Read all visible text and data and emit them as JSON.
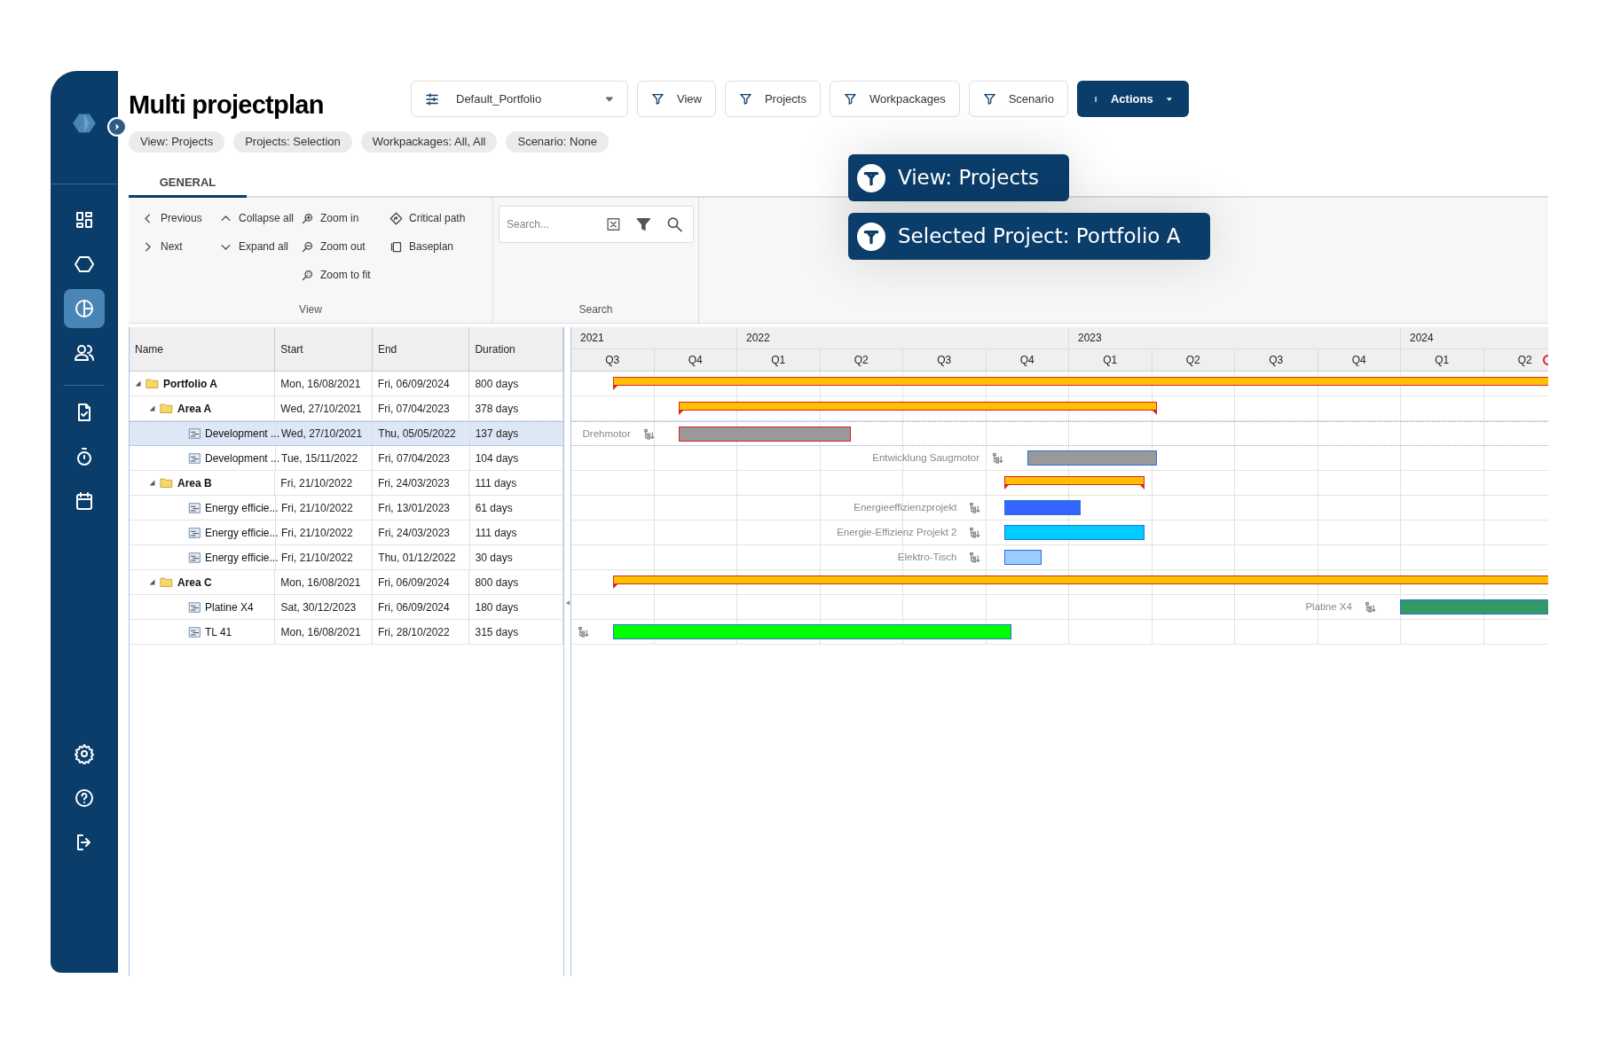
{
  "sidebar": {
    "nav_top": [
      {
        "selected": false
      },
      {
        "selected": false
      },
      {
        "selected": true
      },
      {
        "selected": false
      }
    ],
    "nav_middle": [
      {
        "selected": false
      },
      {
        "selected": false
      },
      {
        "selected": false
      }
    ],
    "nav_bottom": [
      {
        "selected": false
      },
      {
        "selected": false
      },
      {
        "selected": false
      }
    ]
  },
  "header": {
    "title": "Multi projectplan",
    "portfolio_select": {
      "value": "Default_Portfolio"
    },
    "filter_buttons": [
      "View",
      "Projects",
      "Workpackages",
      "Scenario"
    ],
    "actions_button": "Actions",
    "chips": [
      "View: Projects",
      "Projects: Selection",
      "Workpackages: All, All",
      "Scenario: None"
    ]
  },
  "callouts": [
    "View: Projects",
    "Selected Project: Portfolio A"
  ],
  "tabs": [
    {
      "label": "GENERAL",
      "selected": true
    }
  ],
  "ribbon": {
    "view_group": {
      "label": "View",
      "columns": [
        [
          {
            "kind": "previous",
            "label": "Previous"
          },
          {
            "kind": "next",
            "label": "Next"
          }
        ],
        [
          {
            "kind": "collapse",
            "label": "Collapse all"
          },
          {
            "kind": "expand",
            "label": "Expand all"
          }
        ],
        [
          {
            "kind": "zoom_in",
            "label": "Zoom in"
          },
          {
            "kind": "zoom_out",
            "label": "Zoom out"
          },
          {
            "kind": "zoom_fit",
            "label": "Zoom to fit"
          }
        ],
        [
          {
            "kind": "critical",
            "label": "Critical path"
          },
          {
            "kind": "baseplan",
            "label": "Baseplan"
          }
        ]
      ]
    },
    "search_group": {
      "label": "Search",
      "placeholder": "Search..."
    }
  },
  "table": {
    "columns": [
      "Name",
      "Start",
      "End",
      "Duration"
    ],
    "rows": [
      {
        "kind": "folder",
        "name": "Portfolio A",
        "start": "Mon, 16/08/2021",
        "end": "Fri, 06/09/2024",
        "duration": "800 days",
        "expanded": true,
        "selected": false,
        "children": [
          {
            "kind": "folder",
            "name": "Area A",
            "start": "Wed, 27/10/2021",
            "end": "Fri, 07/04/2023",
            "duration": "378 days",
            "expanded": true,
            "selected": false,
            "children": [
              {
                "kind": "task",
                "name": "Development ...",
                "start": "Wed, 27/10/2021",
                "end": "Thu, 05/05/2022",
                "duration": "137 days",
                "selected": true,
                "bar_label": "Drehmotor",
                "color": "#999999",
                "critical": true
              },
              {
                "kind": "task",
                "name": "Development ...",
                "start": "Tue, 15/11/2022",
                "end": "Fri, 07/04/2023",
                "duration": "104 days",
                "selected": false,
                "bar_label": "Entwicklung Saugmotor",
                "color": "#999999",
                "critical": false
              }
            ]
          },
          {
            "kind": "folder",
            "name": "Area B",
            "start": "Fri, 21/10/2022",
            "end": "Fri, 24/03/2023",
            "duration": "111 days",
            "expanded": true,
            "selected": false,
            "children": [
              {
                "kind": "task",
                "name": "Energy efficie...",
                "start": "Fri, 21/10/2022",
                "end": "Fri, 13/01/2023",
                "duration": "61 days",
                "selected": false,
                "bar_label": "Energieeffizienzprojekt",
                "color": "#3366ff",
                "critical": false
              },
              {
                "kind": "task",
                "name": "Energy efficie...",
                "start": "Fri, 21/10/2022",
                "end": "Fri, 24/03/2023",
                "duration": "111 days",
                "selected": false,
                "bar_label": "Energie-Effizienz Projekt 2",
                "color": "#00ccff",
                "critical": false
              },
              {
                "kind": "task",
                "name": "Energy efficie...",
                "start": "Fri, 21/10/2022",
                "end": "Thu, 01/12/2022",
                "duration": "30 days",
                "selected": false,
                "bar_label": "Elektro-Tisch",
                "color": "#99ccff",
                "critical": false
              }
            ]
          },
          {
            "kind": "folder",
            "name": "Area C",
            "start": "Mon, 16/08/2021",
            "end": "Fri, 06/09/2024",
            "duration": "800 days",
            "expanded": true,
            "selected": false,
            "children": [
              {
                "kind": "task",
                "name": "Platine X4",
                "start": "Sat, 30/12/2023",
                "end": "Fri, 06/09/2024",
                "duration": "180 days",
                "selected": false,
                "bar_label": "Platine X4",
                "color": "#339966",
                "critical": false
              },
              {
                "kind": "task",
                "name": "TL 41",
                "start": "Mon, 16/08/2021",
                "end": "Fri, 28/10/2022",
                "duration": "315 days",
                "selected": false,
                "color": "#00ff00",
                "critical": false
              }
            ]
          }
        ]
      }
    ]
  },
  "gantt": {
    "years": [
      {
        "label": "2021",
        "quarters": [
          "Q3",
          "Q4"
        ]
      },
      {
        "label": "2022",
        "quarters": [
          "Q1",
          "Q2",
          "Q3",
          "Q4"
        ]
      },
      {
        "label": "2023",
        "quarters": [
          "Q1",
          "Q2",
          "Q3",
          "Q4"
        ]
      },
      {
        "label": "2024",
        "quarters": [
          "Q1",
          "Q2"
        ]
      }
    ]
  }
}
